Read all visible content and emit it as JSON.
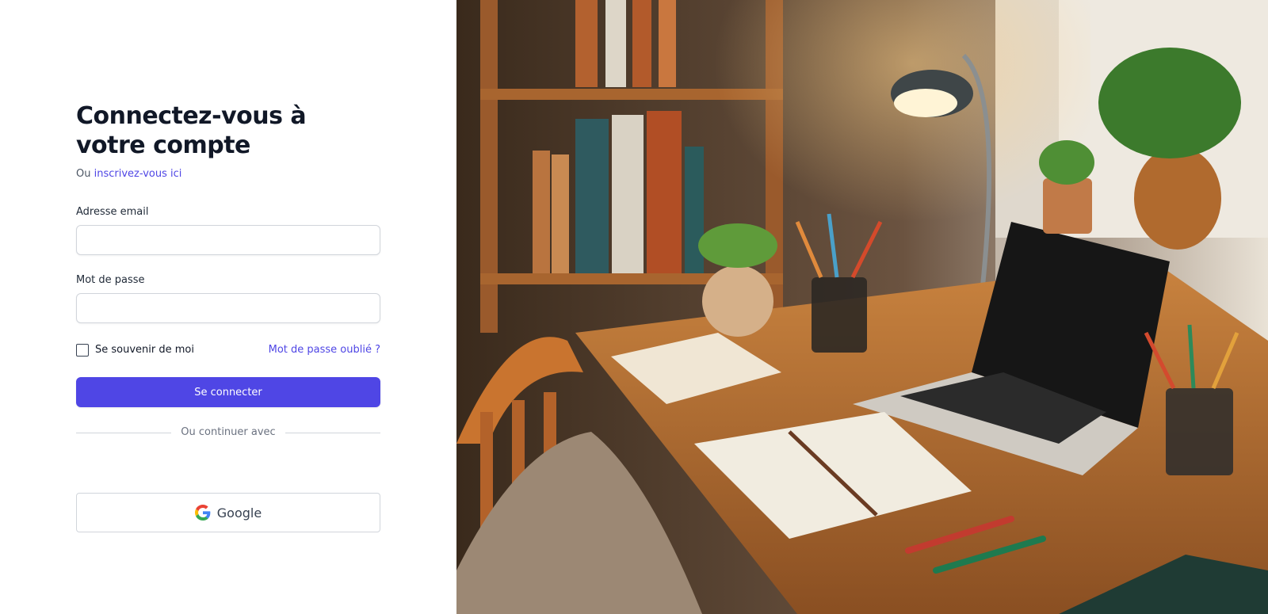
{
  "login": {
    "title": "Connectez-vous à votre compte",
    "subtitle_prefix": "Ou",
    "signup_link": "inscrivez-vous ici",
    "email_label": "Adresse email",
    "email_value": "",
    "password_label": "Mot de passe",
    "password_value": "",
    "remember_label": "Se souvenir de moi",
    "remember_checked": false,
    "forgot_link": "Mot de passe oublié ?",
    "submit_label": "Se connecter",
    "divider_text": "Ou continuer avec",
    "google_label": "Google"
  },
  "colors": {
    "accent": "#4f46e5",
    "text": "#111827",
    "border": "#d1d5db"
  },
  "hero_image": {
    "icon": "desk-workspace-photo"
  }
}
